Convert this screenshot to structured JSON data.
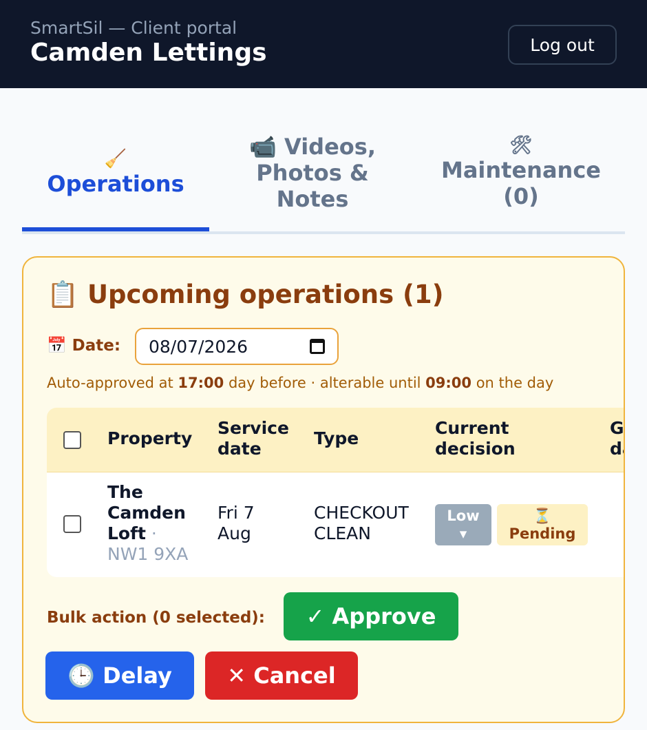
{
  "header": {
    "subtitle": "SmartSil — Client portal",
    "title": "Camden Lettings",
    "logout_label": "Log out"
  },
  "tabs": [
    {
      "icon": "🧹",
      "icon_name": "broom-icon",
      "label": "Operations",
      "active": true
    },
    {
      "icon": "📹",
      "icon_name": "video-camera-icon",
      "label": "Videos, Photos & Notes",
      "line1": "📹 Videos,",
      "line2": "Photos &",
      "line3": "Notes",
      "active": false
    },
    {
      "icon": "🛠",
      "icon_name": "tools-icon",
      "label": "Maintenance (0)",
      "line1": "Maintenance",
      "line2": "(0)",
      "active": false
    }
  ],
  "panel": {
    "title": "📋 Upcoming operations (1)",
    "date_label": "📅 Date:",
    "date_value": "08/07/2026",
    "note": {
      "pre": "Auto-approved at ",
      "time1": "17:00",
      "mid": " day before · alterable until ",
      "time2": "09:00",
      "post": " on the day"
    }
  },
  "table": {
    "columns": [
      "Property",
      "Service date",
      "Type",
      "Current decision",
      "Guest dates"
    ],
    "col_service_l1": "Service",
    "col_service_l2": "date",
    "col_decision_l1": "Current",
    "col_decision_l2": "decision",
    "col_guest_l1": "Guest",
    "col_guest_l2": "dates",
    "rows": [
      {
        "property_l1": "The",
        "property_l2": "Camden",
        "property_l3": "Loft",
        "separator": " ·",
        "postcode": "NW1 9XA",
        "service_l1": "Fri 7",
        "service_l2": "Aug",
        "type_l1": "CHECKOUT",
        "type_l2": "CLEAN",
        "priority": "Low",
        "priority_arrow": "▾",
        "status_icon": "⏳",
        "status": "Pending"
      }
    ]
  },
  "bulk": {
    "label": "Bulk action (0 selected):",
    "approve": "✓ Approve",
    "delay": "🕒 Delay",
    "cancel": "✕ Cancel"
  },
  "colors": {
    "header_bg": "#0f172a",
    "accent": "#1d4ed8",
    "panel_border": "#f0b43c",
    "approve": "#16a34a",
    "delay": "#2563eb",
    "cancel": "#dc2626"
  }
}
